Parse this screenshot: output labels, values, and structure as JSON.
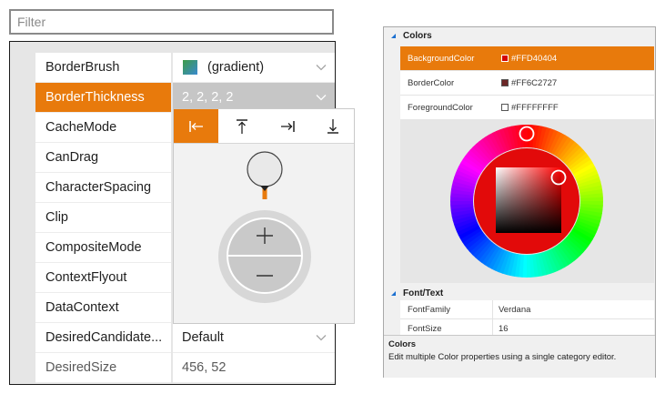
{
  "filter": {
    "placeholder": "Filter"
  },
  "properties": [
    {
      "name": "BorderBrush",
      "value": "(gradient)",
      "swatch": true,
      "dropdown": true
    },
    {
      "name": "BorderThickness",
      "value": "2, 2, 2, 2",
      "dropdown": true,
      "selected": true
    },
    {
      "name": "CacheMode",
      "value": ""
    },
    {
      "name": "CanDrag",
      "value": ""
    },
    {
      "name": "CharacterSpacing",
      "value": ""
    },
    {
      "name": "Clip",
      "value": ""
    },
    {
      "name": "CompositeMode",
      "value": ""
    },
    {
      "name": "ContextFlyout",
      "value": ""
    },
    {
      "name": "DataContext",
      "value": ""
    },
    {
      "name": "DesiredCandidate...",
      "value": "Default",
      "dropdown": true
    },
    {
      "name": "DesiredSize",
      "value": "456, 52",
      "dim": true
    }
  ],
  "flyout": {
    "tabs": [
      "left-edge-icon",
      "top-edge-icon",
      "right-edge-icon",
      "bottom-edge-icon"
    ],
    "active_tab": 0,
    "plus_icon": "plus-icon",
    "minus_icon": "minus-icon",
    "accent": "#e87a0c"
  },
  "colors_panel": {
    "category": "Colors",
    "rows": [
      {
        "name": "BackgroundColor",
        "value": "#FFD40404",
        "swatch": "#D40404",
        "selected": true
      },
      {
        "name": "BorderColor",
        "value": "#FF6C2727",
        "swatch": "#6C2727"
      },
      {
        "name": "ForegroundColor",
        "value": "#FFFFFFFF",
        "swatch": "#FFFFFF"
      }
    ],
    "font_category": "Font/Text",
    "font_rows": [
      {
        "name": "FontFamily",
        "value": "Verdana"
      },
      {
        "name": "FontSize",
        "value": "16"
      }
    ],
    "description_title": "Colors",
    "description_text": "Edit multiple Color properties using a single category editor.",
    "selected_color": "#D40404"
  }
}
